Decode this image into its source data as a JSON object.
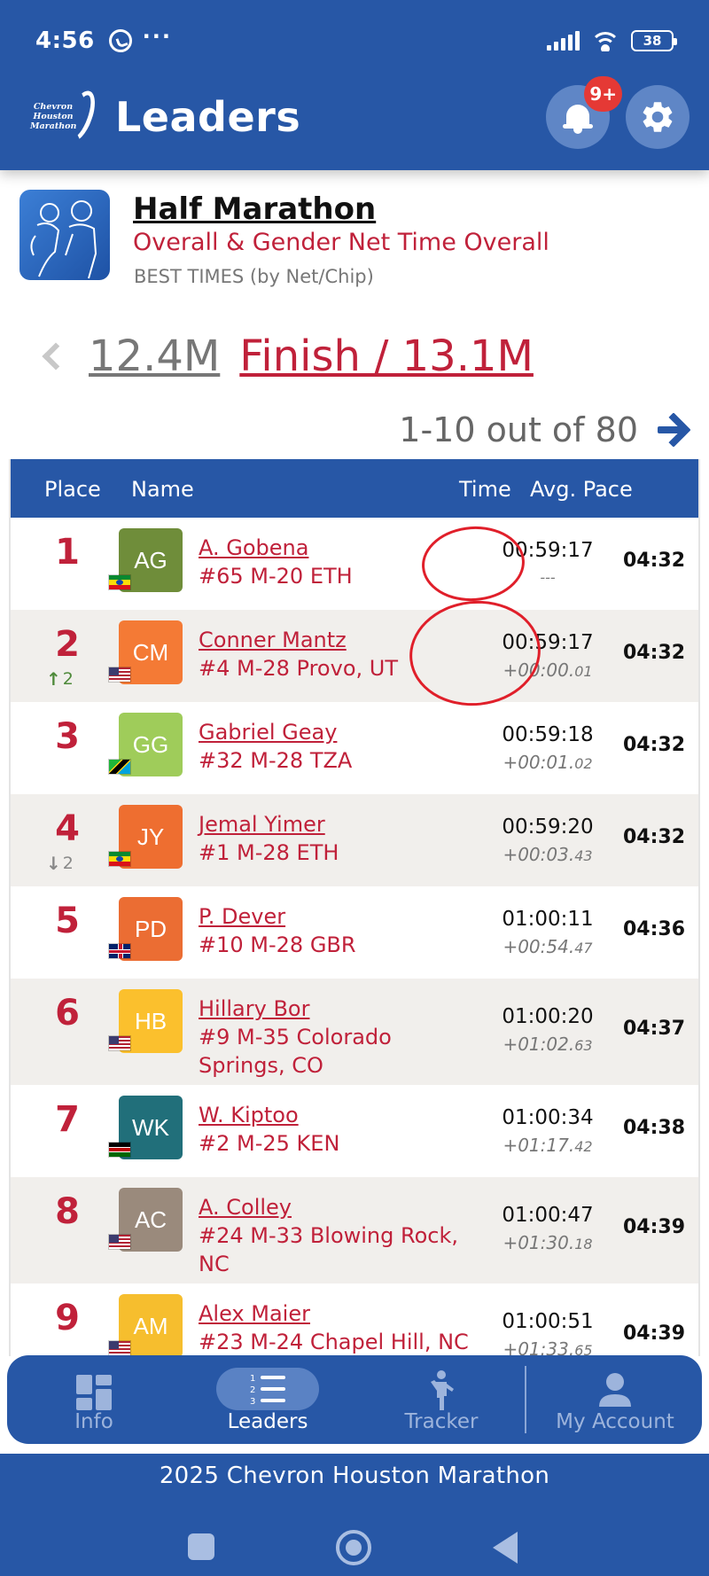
{
  "status_bar": {
    "time": "4:56",
    "battery": "38"
  },
  "header": {
    "title": "Leaders",
    "notification_badge": "9+",
    "logo_text": [
      "Chevron",
      "Houston",
      "Marathon"
    ]
  },
  "event": {
    "title": "Half Marathon",
    "subtitle": "Overall & Gender Net Time Overall",
    "sort_note": "BEST TIMES (by Net/Chip)"
  },
  "splits": {
    "previous": "12.4M",
    "current": "Finish / 13.1M"
  },
  "pager": {
    "range": "1-10 out of 80"
  },
  "table": {
    "headers": {
      "place": "Place",
      "name": "Name",
      "time": "Time",
      "pace": "Avg. Pace"
    },
    "rows": [
      {
        "place": "1",
        "initials": "AG",
        "avatar_color": "#6f8d3a",
        "flag": "ETH",
        "name": "A. Gobena",
        "info": "#65 M-20 ETH",
        "time": "00:59:17",
        "gap": "---",
        "gap_ms": "",
        "pace": "04:32",
        "move": "",
        "move_dir": ""
      },
      {
        "place": "2",
        "initials": "CM",
        "avatar_color": "#f47a35",
        "flag": "USA",
        "name": "Conner Mantz",
        "info": "#4 M-28 Provo, UT",
        "time": "00:59:17",
        "gap": "+00:00.",
        "gap_ms": "01",
        "pace": "04:32",
        "move": "2",
        "move_dir": "up"
      },
      {
        "place": "3",
        "initials": "GG",
        "avatar_color": "#9fcc5a",
        "flag": "TZA",
        "name": "Gabriel Geay",
        "info": "#32 M-28 TZA",
        "time": "00:59:18",
        "gap": "+00:01.",
        "gap_ms": "02",
        "pace": "04:32",
        "move": "",
        "move_dir": ""
      },
      {
        "place": "4",
        "initials": "JY",
        "avatar_color": "#ee6e30",
        "flag": "ETH",
        "name": "Jemal Yimer",
        "info": "#1 M-28 ETH",
        "time": "00:59:20",
        "gap": "+00:03.",
        "gap_ms": "43",
        "pace": "04:32",
        "move": "2",
        "move_dir": "down"
      },
      {
        "place": "5",
        "initials": "PD",
        "avatar_color": "#eb6d33",
        "flag": "GBR",
        "name": "P. Dever",
        "info": "#10 M-28 GBR",
        "time": "01:00:11",
        "gap": "+00:54.",
        "gap_ms": "47",
        "pace": "04:36",
        "move": "",
        "move_dir": ""
      },
      {
        "place": "6",
        "initials": "HB",
        "avatar_color": "#fbc02d",
        "flag": "USA",
        "name": "Hillary Bor",
        "info": "#9 M-35 Colorado Springs, CO",
        "time": "01:00:20",
        "gap": "+01:02.",
        "gap_ms": "63",
        "pace": "04:37",
        "move": "",
        "move_dir": ""
      },
      {
        "place": "7",
        "initials": "WK",
        "avatar_color": "#216f7a",
        "flag": "KEN",
        "name": "W. Kiptoo",
        "info": "#2 M-25 KEN",
        "time": "01:00:34",
        "gap": "+01:17.",
        "gap_ms": "42",
        "pace": "04:38",
        "move": "",
        "move_dir": ""
      },
      {
        "place": "8",
        "initials": "AC",
        "avatar_color": "#9a8a7c",
        "flag": "USA",
        "name": "A. Colley",
        "info": "#24 M-33 Blowing Rock, NC",
        "time": "01:00:47",
        "gap": "+01:30.",
        "gap_ms": "18",
        "pace": "04:39",
        "move": "",
        "move_dir": ""
      },
      {
        "place": "9",
        "initials": "AM",
        "avatar_color": "#f6be2e",
        "flag": "USA",
        "name": "Alex Maier",
        "info": "#23 M-24 Chapel Hill, NC",
        "time": "01:00:51",
        "gap": "+01:33.",
        "gap_ms": "65",
        "pace": "04:39",
        "move": "",
        "move_dir": ""
      }
    ]
  },
  "bottom_nav": {
    "items": [
      {
        "label": "Info",
        "icon": "dashboard-icon"
      },
      {
        "label": "Leaders",
        "icon": "numbered-list-icon"
      },
      {
        "label": "Tracker",
        "icon": "runner-icon"
      },
      {
        "label": "My Account",
        "icon": "person-icon"
      }
    ],
    "active": "Leaders"
  },
  "footer": {
    "text": "2025 Chevron Houston Marathon"
  },
  "colors": {
    "brand_blue": "#2757a6",
    "accent_red": "#c0213a",
    "badge_red": "#e53935"
  }
}
